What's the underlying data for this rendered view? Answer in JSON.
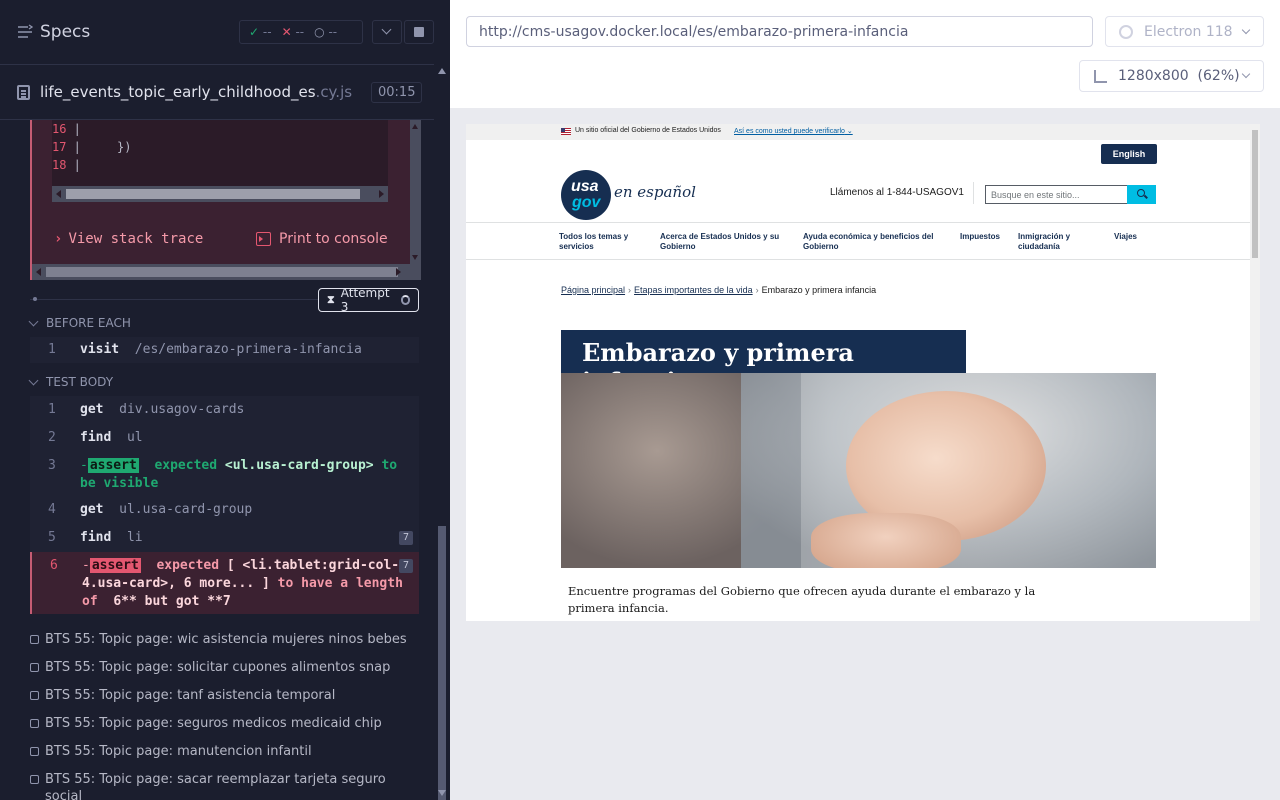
{
  "reporter": {
    "header_title": "Specs",
    "stats": {
      "passed": "--",
      "failed": "--",
      "pending": "--"
    },
    "spec_file": {
      "name": "life_events_topic_early_childhood_es",
      "ext": ".cy.js",
      "duration": "00:15"
    },
    "code_frame": [
      {
        "ln": "16",
        "code": " |"
      },
      {
        "ln": "17",
        "code": " |     })"
      },
      {
        "ln": "18",
        "code": " |"
      }
    ],
    "view_stack_trace": "View stack trace",
    "print_to_console": "Print to console",
    "attempt_label": "Attempt 3",
    "before_each_label": "BEFORE EACH",
    "before_each": [
      {
        "num": "1",
        "name": "visit",
        "arg": "/es/embarazo-primera-infancia"
      }
    ],
    "test_body_label": "TEST BODY",
    "test_body": [
      {
        "num": "1",
        "name": "get",
        "arg": "div.usagov-cards"
      },
      {
        "num": "2",
        "name": "find",
        "arg": "ul"
      },
      {
        "num": "3",
        "tag": "assert",
        "expected": "expected",
        "subject": "<ul.usa-card-group>",
        "to_be": "to be",
        "visible": "visible"
      },
      {
        "num": "4",
        "name": "get",
        "arg": "ul.usa-card-group"
      },
      {
        "num": "5",
        "name": "find",
        "arg": "li",
        "count": "7"
      },
      {
        "num": "6",
        "tag": "assert",
        "expected": "expected",
        "subject": "[ <li.tablet:grid-col-4.usa-card>, 6 more... ]",
        "rest": "to have a length",
        "of": "of",
        "tail": "6** but got **7",
        "count": "7"
      }
    ],
    "tests": [
      "BTS 55: Topic page: wic asistencia mujeres ninos bebes",
      "BTS 55: Topic page: solicitar cupones alimentos snap",
      "BTS 55: Topic page: tanf asistencia temporal",
      "BTS 55: Topic page: seguros medicos medicaid chip",
      "BTS 55: Topic page: manutencion infantil",
      "BTS 55: Topic page: sacar reemplazar tarjeta seguro social"
    ]
  },
  "aut": {
    "url": "http://cms-usagov.docker.local/es/embarazo-primera-infancia",
    "browser": "Electron 118",
    "viewport": "1280x800",
    "zoom": "(62%)",
    "site": {
      "banner_text": "Un sitio oficial del Gobierno de Estados Unidos",
      "banner_link": "Así es como usted puede verificarlo",
      "english_button": "English",
      "logo_top": "usa",
      "logo_bottom": "gov",
      "logo_tagline": "en español",
      "phone": "Llámenos al 1-844-USAGOV1",
      "search_placeholder": "Busque en este sitio...",
      "nav": [
        "Todos los temas y servicios",
        "Acerca de Estados Unidos y su Gobierno",
        "Ayuda económica y beneficios del Gobierno",
        "Impuestos",
        "Inmigración y ciudadanía",
        "Viajes"
      ],
      "breadcrumb": [
        "Página principal",
        "Etapas importantes de la vida",
        "Embarazo y primera infancia"
      ],
      "title": "Embarazo y primera infancia",
      "description": "Encuentre programas del Gobierno que ofrecen ayuda durante el embarazo y la primera infancia."
    }
  }
}
